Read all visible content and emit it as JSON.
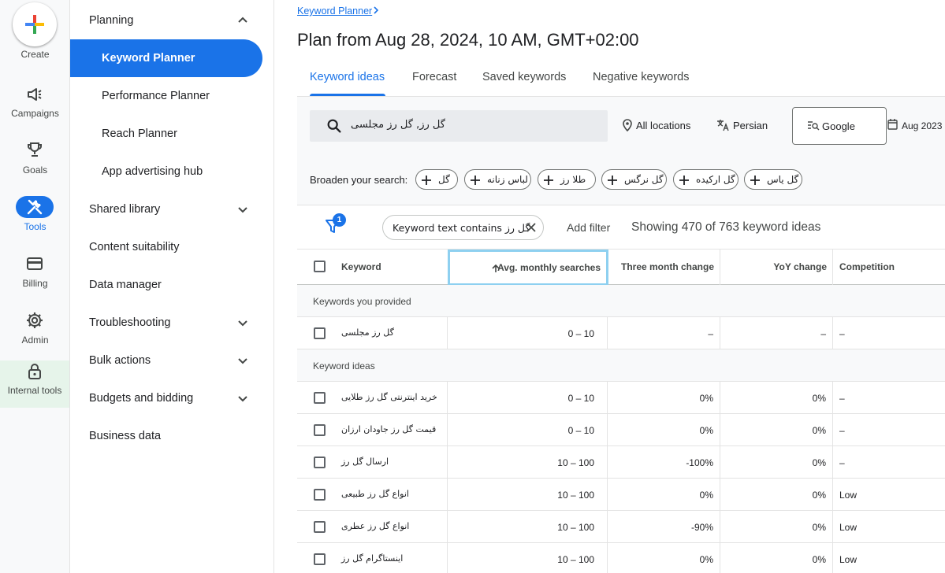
{
  "rail": {
    "create_label": "Create",
    "items": [
      {
        "label": "Campaigns"
      },
      {
        "label": "Goals"
      },
      {
        "label": "Tools"
      },
      {
        "label": "Billing"
      },
      {
        "label": "Admin"
      },
      {
        "label": "Internal tools"
      }
    ]
  },
  "sidenav": {
    "items": [
      {
        "label": "Planning",
        "expanded": true
      },
      {
        "label": "Keyword Planner",
        "active": true
      },
      {
        "label": "Performance Planner"
      },
      {
        "label": "Reach Planner"
      },
      {
        "label": "App advertising hub"
      },
      {
        "label": "Shared library"
      },
      {
        "label": "Content suitability"
      },
      {
        "label": "Data manager"
      },
      {
        "label": "Troubleshooting"
      },
      {
        "label": "Bulk actions"
      },
      {
        "label": "Budgets and bidding"
      },
      {
        "label": "Business data"
      }
    ]
  },
  "breadcrumb": "Keyword Planner",
  "page_title": "Plan from Aug 28, 2024, 10 AM, GMT+02:00",
  "tabs": [
    {
      "label": "Keyword ideas",
      "active": true
    },
    {
      "label": "Forecast"
    },
    {
      "label": "Saved keywords"
    },
    {
      "label": "Negative keywords"
    }
  ],
  "toolbar": {
    "search_value": "گل رز, گل رز مجلسی",
    "location": "All locations",
    "language": "Persian",
    "network": "Google",
    "date": "Aug 2023"
  },
  "broaden": {
    "label": "Broaden your search:",
    "chips": [
      "گل",
      "لباس زنانه",
      "طلا رز",
      "گل نرگس",
      "گل ارکیده",
      "گل یاس"
    ]
  },
  "filterbar": {
    "badge": "1",
    "filter_chip": "Keyword text contains گل رز",
    "add_filter": "Add filter",
    "showing": "Showing 470 of 763 keyword ideas"
  },
  "table": {
    "headers": {
      "keyword": "Keyword",
      "avg": "Avg. monthly searches",
      "three_month": "Three month change",
      "yoy": "YoY change",
      "competition": "Competition"
    },
    "group_provided": "Keywords you provided",
    "group_ideas": "Keyword ideas",
    "provided_rows": [
      {
        "keyword": "گل رز مجلسی",
        "avg": "0 – 10",
        "three": "–",
        "yoy": "–",
        "comp": "–"
      }
    ],
    "idea_rows": [
      {
        "keyword": "خرید اینترنتی گل رز طلایی",
        "avg": "0 – 10",
        "three": "0%",
        "yoy": "0%",
        "comp": "–"
      },
      {
        "keyword": "قیمت گل رز جاودان ارزان",
        "avg": "0 – 10",
        "three": "0%",
        "yoy": "0%",
        "comp": "–"
      },
      {
        "keyword": "ارسال گل رز",
        "avg": "10 – 100",
        "three": "-100%",
        "yoy": "0%",
        "comp": "–"
      },
      {
        "keyword": "انواع گل رز طبیعی",
        "avg": "10 – 100",
        "three": "0%",
        "yoy": "0%",
        "comp": "Low"
      },
      {
        "keyword": "انواع گل رز عطری",
        "avg": "10 – 100",
        "three": "-90%",
        "yoy": "0%",
        "comp": "Low"
      },
      {
        "keyword": "اینستاگرام گل رز",
        "avg": "10 – 100",
        "three": "0%",
        "yoy": "0%",
        "comp": "Low"
      }
    ]
  },
  "colors": {
    "accent": "#1a73e8",
    "internal_bg": "#e6f4ea"
  }
}
